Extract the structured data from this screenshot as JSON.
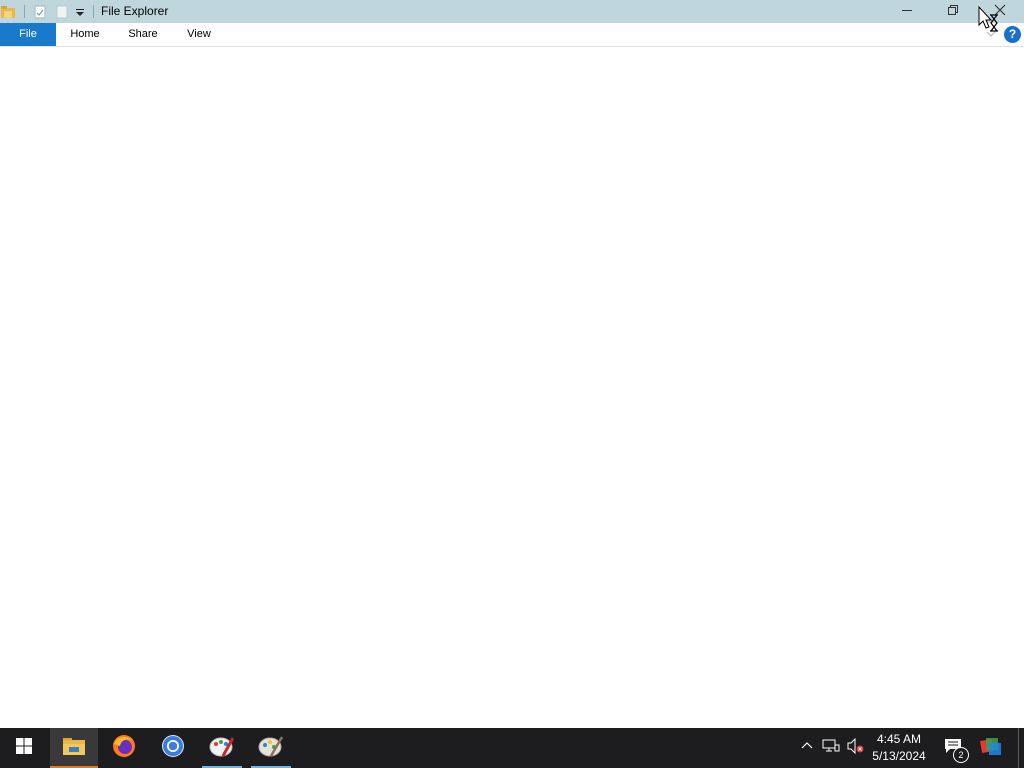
{
  "window": {
    "title": "File Explorer",
    "controls": {
      "minimize": "minimize-icon",
      "maximize": "restore-icon",
      "close": "close-icon"
    }
  },
  "ribbon": {
    "tabs": [
      {
        "label": "File",
        "active": true
      },
      {
        "label": "Home"
      },
      {
        "label": "Share"
      },
      {
        "label": "View"
      }
    ],
    "help": "?"
  },
  "taskbar": {
    "apps": [
      {
        "name": "start",
        "icon": "windows-logo-icon"
      },
      {
        "name": "file-explorer",
        "icon": "folder-icon",
        "active": true
      },
      {
        "name": "firefox",
        "icon": "firefox-icon"
      },
      {
        "name": "chrome",
        "icon": "chrome-icon"
      },
      {
        "name": "paint",
        "icon": "paint-icon"
      },
      {
        "name": "paint-3d",
        "icon": "palette-icon"
      }
    ],
    "clock": {
      "time": "4:45 AM",
      "date": "5/13/2024"
    },
    "notifications": {
      "count": "2"
    }
  },
  "colors": {
    "titlebar": "#bfd6dc",
    "file_tab": "#1979ca",
    "taskbar": "#1d1d1f",
    "explorer_accent": "#e07c1f"
  }
}
